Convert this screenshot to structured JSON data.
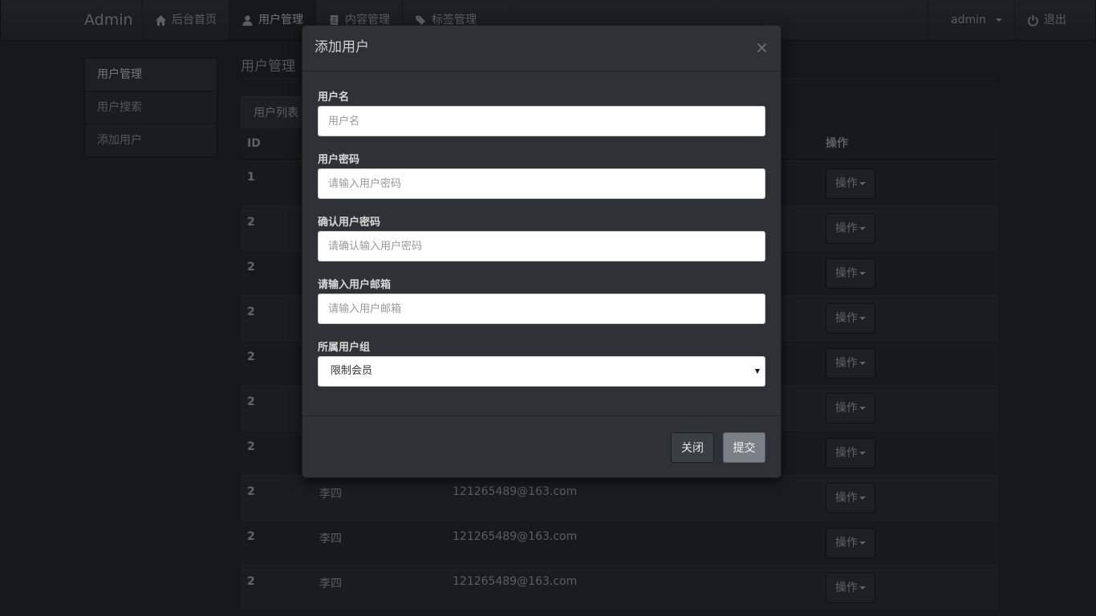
{
  "navbar": {
    "brand": "Admin",
    "items": [
      {
        "label": "后台首页",
        "icon": "home-icon"
      },
      {
        "label": "用户管理",
        "icon": "user-icon",
        "active": true
      },
      {
        "label": "内容管理",
        "icon": "document-icon"
      },
      {
        "label": "标签管理",
        "icon": "tags-icon"
      }
    ],
    "user": "admin",
    "logout": "退出"
  },
  "sidebar": {
    "items": [
      {
        "label": "用户管理"
      },
      {
        "label": "用户搜索"
      },
      {
        "label": "添加用户"
      }
    ]
  },
  "main": {
    "title": "用户管理",
    "tab": "用户列表",
    "table": {
      "headers": {
        "id": "ID",
        "action": "操作"
      },
      "action_label": "操作",
      "rows": [
        {
          "id": "1",
          "name": "",
          "email": ""
        },
        {
          "id": "2",
          "name": "",
          "email": ""
        },
        {
          "id": "2",
          "name": "",
          "email": ""
        },
        {
          "id": "2",
          "name": "",
          "email": ""
        },
        {
          "id": "2",
          "name": "",
          "email": ""
        },
        {
          "id": "2",
          "name": "",
          "email": ""
        },
        {
          "id": "2",
          "name": "",
          "email": ""
        },
        {
          "id": "2",
          "name": "李四",
          "email": "121265489@163.com"
        },
        {
          "id": "2",
          "name": "李四",
          "email": "121265489@163.com"
        },
        {
          "id": "2",
          "name": "李四",
          "email": "121265489@163.com"
        }
      ]
    }
  },
  "modal": {
    "title": "添加用户",
    "close_glyph": "×",
    "fields": {
      "username": {
        "label": "用户名",
        "placeholder": "用户名",
        "value": ""
      },
      "password": {
        "label": "用户密码",
        "placeholder": "请输入用户密码",
        "value": ""
      },
      "confirm": {
        "label": "确认用户密码",
        "placeholder": "请确认输入用户密码",
        "value": ""
      },
      "email": {
        "label": "请输入用户邮箱",
        "placeholder": "请输入用户邮箱",
        "value": ""
      },
      "group": {
        "label": "所属用户组",
        "selected": "限制会员"
      }
    },
    "buttons": {
      "close": "关闭",
      "submit": "提交"
    }
  }
}
